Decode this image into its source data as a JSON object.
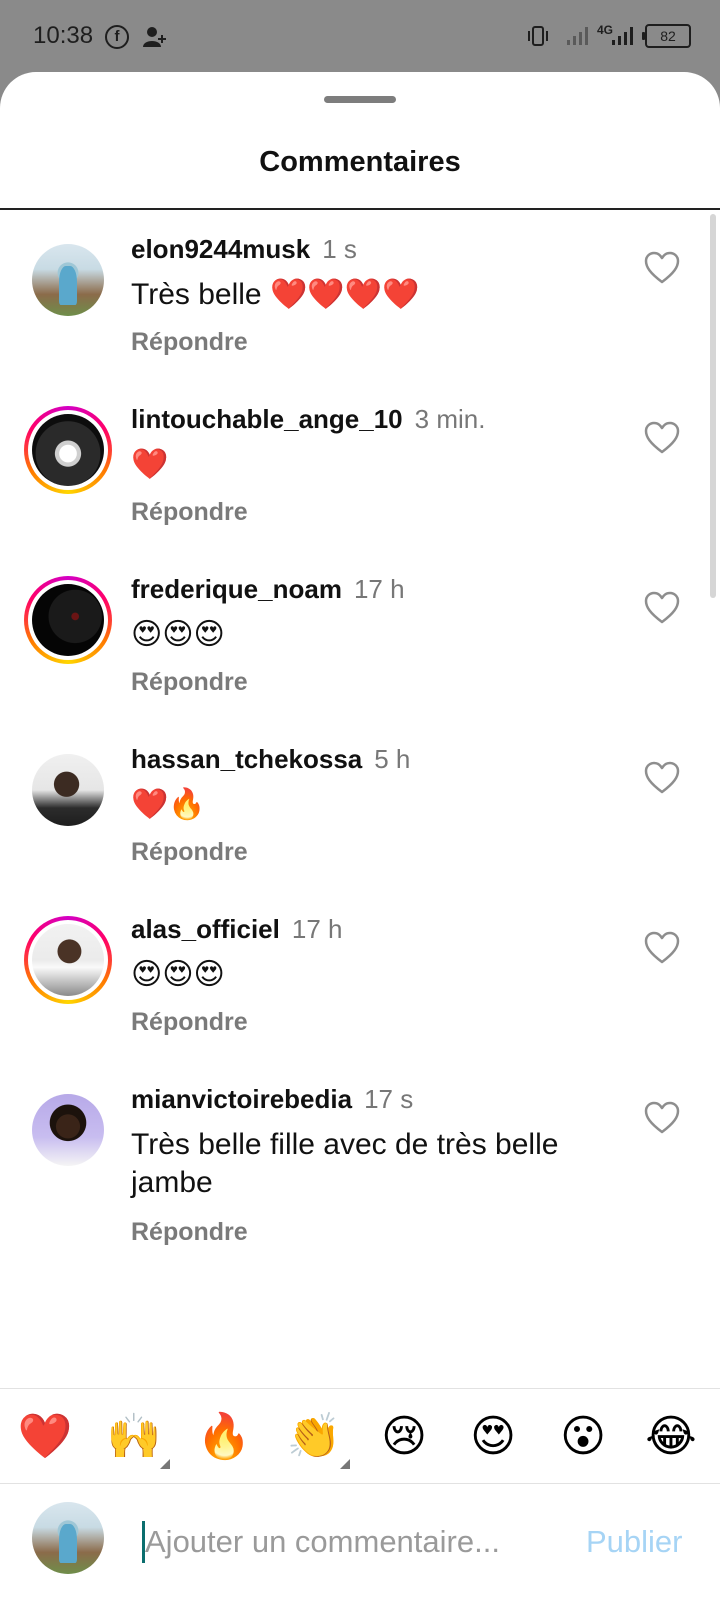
{
  "status_bar": {
    "time": "10:38",
    "network": "4G",
    "battery": "82",
    "icons": [
      "facebook-icon",
      "person-add-icon",
      "vibrate-icon",
      "signal-icon",
      "signal-icon",
      "battery-icon"
    ]
  },
  "sheet": {
    "title": "Commentaires"
  },
  "comments": [
    {
      "username": "elon9244musk",
      "time": "1 s",
      "text": "Très belle ❤️❤️❤️❤️",
      "reply": "Répondre",
      "story_ring": false
    },
    {
      "username": "lintouchable_ange_10",
      "time": "3 min.",
      "text": "❤️",
      "reply": "Répondre",
      "story_ring": true
    },
    {
      "username": "frederique_noam",
      "time": "17 h",
      "text": "😍😍😍",
      "reply": "Répondre",
      "story_ring": true
    },
    {
      "username": "hassan_tchekossa",
      "time": "5 h",
      "text": "❤️🔥",
      "reply": "Répondre",
      "story_ring": false
    },
    {
      "username": "alas_officiel",
      "time": "17 h",
      "text": "😍😍😍",
      "reply": "Répondre",
      "story_ring": true
    },
    {
      "username": "mianvictoirebedia",
      "time": "17 s",
      "text": "Très belle fille avec de très belle jambe",
      "reply": "Répondre",
      "story_ring": false
    }
  ],
  "emoji_bar": [
    "❤️",
    "🙌",
    "🔥",
    "👏",
    "😢",
    "😍",
    "😮",
    "😂"
  ],
  "composer": {
    "placeholder": "Ajouter un commentaire...",
    "publish_label": "Publier",
    "publish_color": "#a6d4f5"
  },
  "colors": {
    "story_ring": "#ff0069",
    "status_bar_bg": "#8a8a8a",
    "meta_text": "#777777"
  },
  "nav_bar": [
    "square-recents-icon",
    "circle-home-icon",
    "triangle-back-icon"
  ]
}
